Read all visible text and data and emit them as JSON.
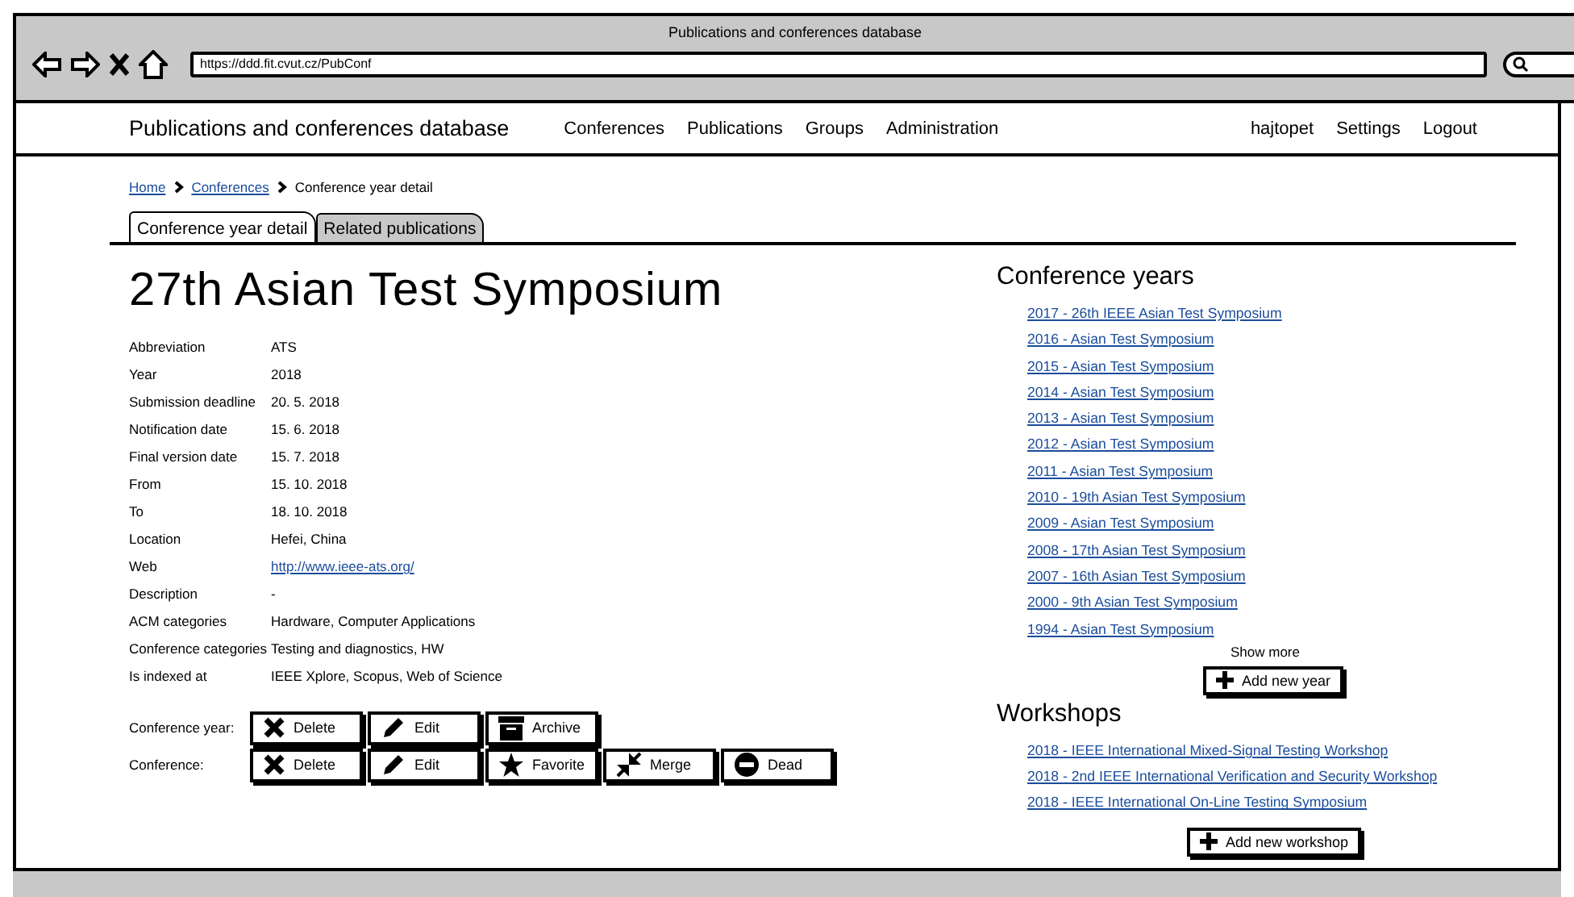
{
  "browser": {
    "title": "Publications and conferences database",
    "url": "https://ddd.fit.cvut.cz/PubConf"
  },
  "navbar": {
    "brand": "Publications and conferences database",
    "links": [
      "Conferences",
      "Publications",
      "Groups",
      "Administration"
    ],
    "user_links": [
      "hajtopet",
      "Settings",
      "Logout"
    ]
  },
  "breadcrumb": [
    {
      "label": "Home",
      "link": true
    },
    {
      "label": "Conferences",
      "link": true
    },
    {
      "label": "Conference year detail",
      "link": false
    }
  ],
  "tabs": [
    {
      "label": "Conference year detail",
      "selected": true
    },
    {
      "label": "Related publications",
      "selected": false
    }
  ],
  "title": "27th Asian Test Symposium",
  "details": [
    {
      "label": "Abbreviation",
      "value": "ATS",
      "link": false
    },
    {
      "label": "Year",
      "value": "2018",
      "link": false
    },
    {
      "label": "Submission deadline",
      "value": "20. 5. 2018",
      "link": false
    },
    {
      "label": "Notification date",
      "value": "15. 6. 2018",
      "link": false
    },
    {
      "label": "Final version date",
      "value": "15. 7. 2018",
      "link": false
    },
    {
      "label": "From",
      "value": "15. 10. 2018",
      "link": false
    },
    {
      "label": "To",
      "value": "18. 10. 2018",
      "link": false
    },
    {
      "label": "Location",
      "value": "Hefei, China",
      "link": false
    },
    {
      "label": "Web",
      "value": "http://www.ieee-ats.org/",
      "link": true
    },
    {
      "label": "Description",
      "value": "-",
      "link": false
    },
    {
      "label": "ACM categories",
      "value": "Hardware, Computer Applications",
      "link": false
    },
    {
      "label": "Conference categories",
      "value": "Testing and diagnostics, HW",
      "link": false
    },
    {
      "label": "Is indexed at",
      "value": "IEEE Xplore, Scopus, Web of Science",
      "link": false
    }
  ],
  "action_rows": [
    {
      "label": "Conference year:",
      "buttons": [
        {
          "label": "Delete",
          "kind": "delete"
        },
        {
          "label": "Edit",
          "kind": "edit"
        },
        {
          "label": "Archive",
          "kind": "archive"
        }
      ]
    },
    {
      "label": "Conference:",
      "buttons": [
        {
          "label": "Delete",
          "kind": "delete"
        },
        {
          "label": "Edit",
          "kind": "edit"
        },
        {
          "label": "Favorite",
          "kind": "favorite"
        },
        {
          "label": "Merge",
          "kind": "merge"
        },
        {
          "label": "Dead",
          "kind": "dead"
        }
      ]
    }
  ],
  "conference_years": {
    "heading": "Conference years",
    "items": [
      "2017 - 26th IEEE Asian Test Symposium",
      "2016 - Asian Test Symposium",
      "2015 - Asian Test Symposium",
      "2014 - Asian Test Symposium",
      "2013 - Asian Test Symposium",
      "2012 - Asian Test Symposium",
      "2011 - Asian Test Symposium",
      "2010 - 19th Asian Test Symposium",
      "2009 - Asian Test Symposium",
      "2008 - 17th Asian Test Symposium",
      "2007 - 16th Asian Test Symposium",
      "2000 - 9th Asian Test Symposium",
      "1994 - Asian Test Symposium"
    ],
    "show_more": "Show more",
    "add_button": "Add new year"
  },
  "workshops": {
    "heading": "Workshops",
    "items": [
      "2018 - IEEE International Mixed-Signal Testing Workshop",
      "2018 - 2nd IEEE International Verification and Security Workshop",
      "2018 - IEEE International On-Line Testing Symposium"
    ],
    "add_button": "Add new workshop"
  }
}
